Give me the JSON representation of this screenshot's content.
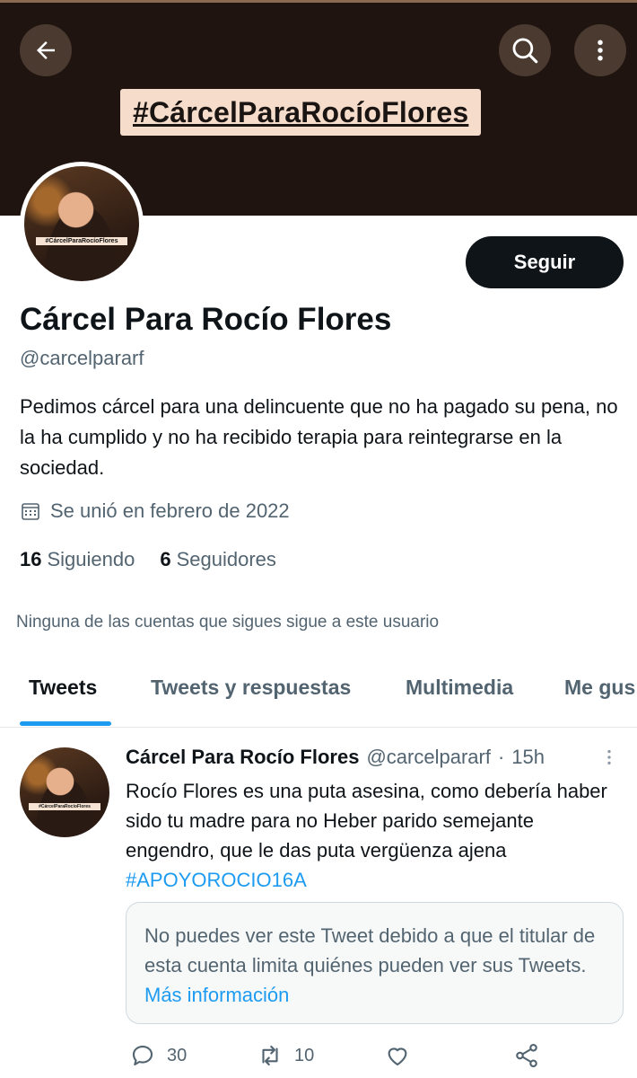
{
  "header": {
    "banner_hashtag": "#CárcelParaRocíoFlores",
    "back_icon": "arrow-left-icon",
    "search_icon": "search-icon",
    "more_icon": "more-vertical-icon"
  },
  "profile": {
    "avatar_label": "#CárcelParaRocíoFlores",
    "follow_label": "Seguir",
    "name": "Cárcel Para Rocío Flores",
    "handle": "@carcelpararf",
    "bio": "Pedimos cárcel para una delincuente que no ha pagado su pena, no la ha cumplido y no ha recibido terapia para reintegrarse en la sociedad.",
    "joined": "Se unió en febrero de 2022",
    "following_count": "16",
    "following_label": "Siguiendo",
    "followers_count": "6",
    "followers_label": "Seguidores",
    "mutuals_text": "Ninguna de las cuentas que sigues sigue a este usuario"
  },
  "tabs": [
    {
      "label": "Tweets",
      "active": true
    },
    {
      "label": "Tweets y respuestas",
      "active": false
    },
    {
      "label": "Multimedia",
      "active": false
    },
    {
      "label": "Me gus",
      "active": false
    }
  ],
  "tweet": {
    "name": "Cárcel Para Rocío Flores",
    "handle": "@carcelpararf",
    "separator": "·",
    "time": "15h",
    "text": "Rocío Flores es una puta asesina, como debería haber sido tu madre para no Heber parido semejante engendro, que le das puta vergüenza ajena",
    "hashtag": "#APOYOROCIO16A",
    "restricted_text": "No puedes ver este Tweet debido a que el titular de esta cuenta limita quiénes pueden ver sus Tweets.",
    "restricted_link": "Más información",
    "replies": "30",
    "retweets": "10"
  },
  "colors": {
    "accent": "#1d9bf0",
    "banner": "#1f1410",
    "text_primary": "#0f1419",
    "text_secondary": "#536471"
  }
}
